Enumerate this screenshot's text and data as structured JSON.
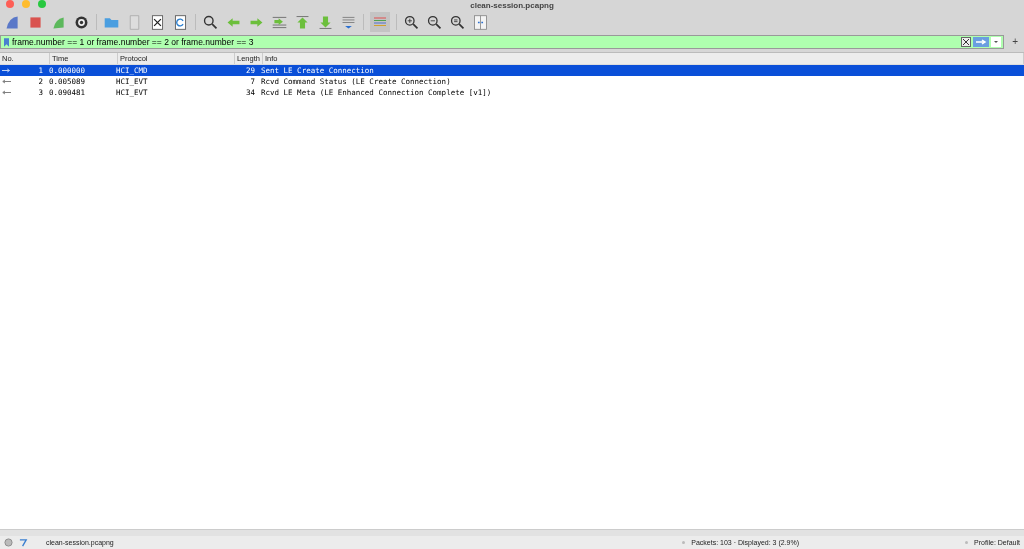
{
  "window": {
    "title": "clean-session.pcapng"
  },
  "filter": {
    "value": "frame.number == 1 or frame.number == 2 or frame.number == 3"
  },
  "add_button": "+",
  "table": {
    "columns": [
      "No.",
      "Time",
      "Protocol",
      "Length",
      "Info"
    ],
    "rows": [
      {
        "kind": "sent",
        "selected": true,
        "cells": [
          "1",
          "0.000000",
          "HCI_CMD",
          "29",
          "Sent LE Create Connection"
        ]
      },
      {
        "kind": "received",
        "selected": false,
        "cells": [
          "2",
          "0.005089",
          "HCI_EVT",
          "7",
          "Rcvd Command Status (LE Create Connection)"
        ]
      },
      {
        "kind": "received",
        "selected": false,
        "cells": [
          "3",
          "0.090481",
          "HCI_EVT",
          "34",
          "Rcvd LE Meta (LE Enhanced Connection Complete [v1])"
        ]
      }
    ]
  },
  "status_bar": {
    "file": "clean-session.pcapng",
    "packets": "Packets: 103 · Displayed: 3 (2.9%)",
    "profile": "Profile: Default"
  }
}
